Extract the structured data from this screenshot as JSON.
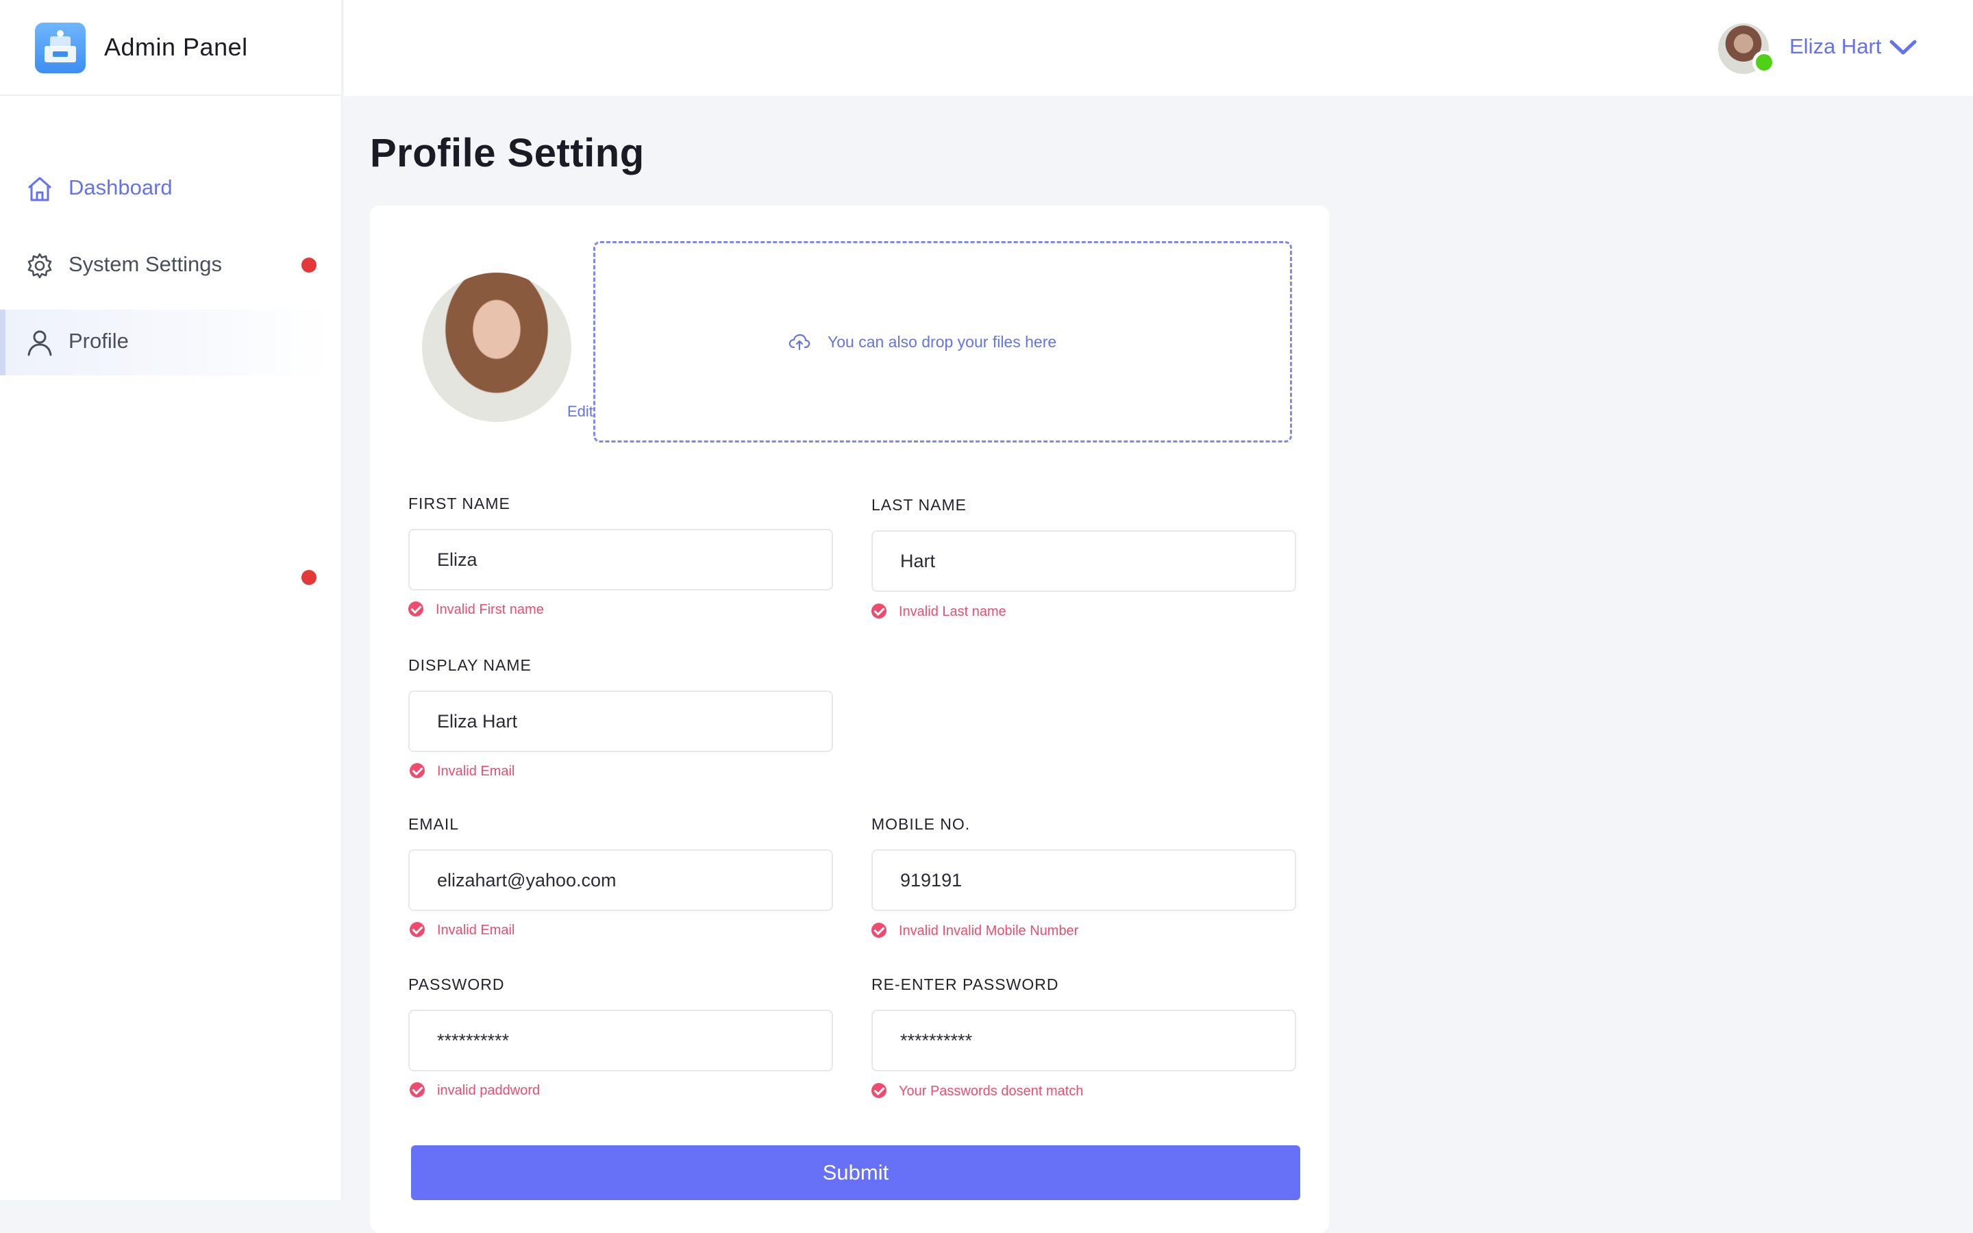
{
  "app": {
    "title": "Admin Panel"
  },
  "sidebar": {
    "items": [
      {
        "label": "Dashboard",
        "icon": "home-icon",
        "active": true
      },
      {
        "label": "System Settings",
        "icon": "gear-icon",
        "notification": true
      },
      {
        "label": "Profile",
        "icon": "user-icon",
        "selected": true
      }
    ]
  },
  "header": {
    "user_name": "Eliza Hart",
    "status": "online"
  },
  "page": {
    "title": "Profile Setting"
  },
  "upload": {
    "edit_label": "Edit",
    "drop_text": "You can also drop your files here",
    "icon": "cloud-upload-icon"
  },
  "form": {
    "first_name": {
      "label": "FIRST NAME",
      "value": "Eliza",
      "error": "Invalid First name"
    },
    "last_name": {
      "label": "LAST NAME",
      "value": "Hart",
      "error": "Invalid Last name"
    },
    "display_name": {
      "label": "DISPLAY NAME",
      "value": "Eliza Hart",
      "error": "Invalid Email"
    },
    "email": {
      "label": "EMAIL",
      "value": "elizahart@yahoo.com",
      "error": "Invalid Email"
    },
    "mobile": {
      "label": "MOBILE NO.",
      "value": "919191",
      "error": "Invalid Invalid Mobile Number"
    },
    "password": {
      "label": "PASSWORD",
      "value": "**********",
      "error": "invalid paddword"
    },
    "confirm_password": {
      "label": "RE-ENTER PASSWORD",
      "value": "**********",
      "error": "Your Passwords dosent match"
    },
    "submit_label": "Submit"
  },
  "colors": {
    "accent": "#6372f0",
    "button": "#6671f8",
    "error": "#f04b6c",
    "notification": "#e53939",
    "online": "#4fd117",
    "background": "#f4f5f9"
  }
}
